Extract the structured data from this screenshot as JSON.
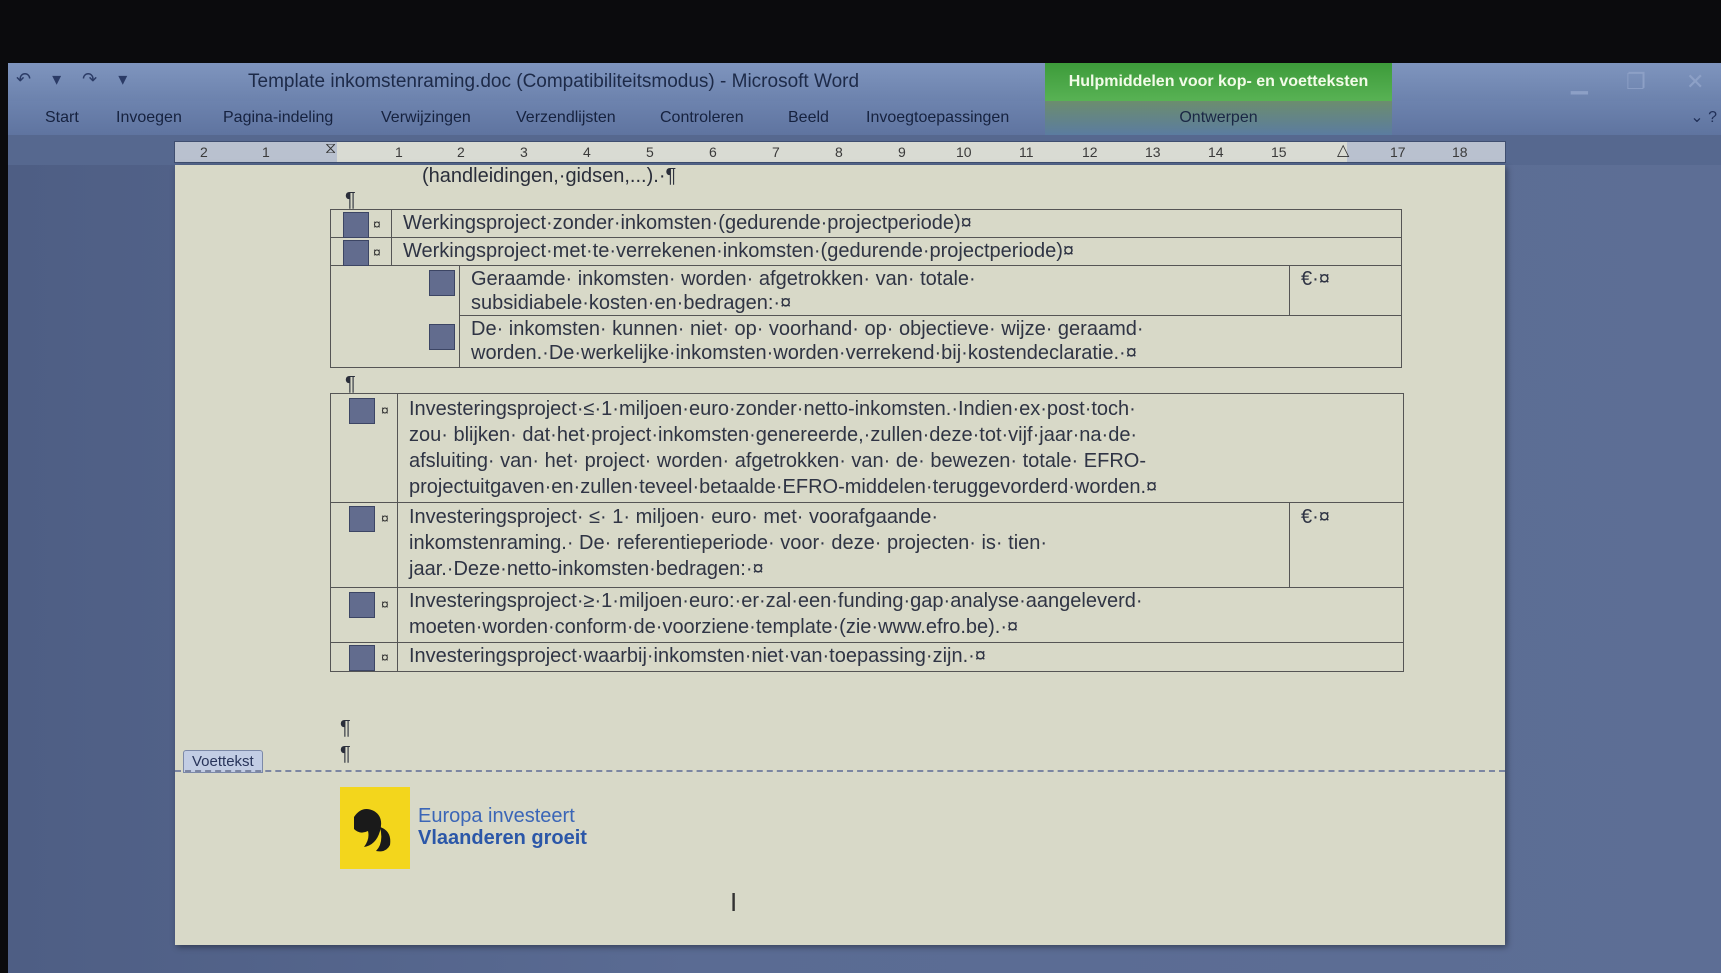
{
  "app": {
    "doc_title": "Template inkomstenraming.doc (Compatibiliteitsmodus) - Microsoft Word",
    "context_tab_group": "Hulpmiddelen voor kop- en voetteksten"
  },
  "ribbon": {
    "tabs": [
      "Start",
      "Invoegen",
      "Pagina-indeling",
      "Verwijzingen",
      "Verzendlijsten",
      "Controleren",
      "Beeld",
      "Invoegtoepassingen"
    ],
    "context_tab": "Ontwerpen"
  },
  "ruler": {
    "numbers": [
      "2",
      "1",
      "1",
      "2",
      "3",
      "4",
      "5",
      "6",
      "7",
      "8",
      "9",
      "10",
      "11",
      "12",
      "13",
      "14",
      "15",
      "17",
      "18"
    ]
  },
  "document": {
    "top_line": "(handleidingen,·gidsen,...).·¶",
    "pilcrow": "¶",
    "table1": {
      "rows": [
        "Werkingsproject·zonder·inkomsten·(gedurende·projectperiode)¤",
        "Werkingsproject·met·te·verrekenen·inkomsten·(gedurende·projectperiode)¤"
      ],
      "sub1_line1": "Geraamde· inkomsten· worden· afgetrokken· van· totale·",
      "sub1_line2": "subsidiabele·kosten·en·bedragen:·¤",
      "sub1_currency": "€·¤",
      "sub2_line1": "De· inkomsten· kunnen· niet· op· voorhand· op· objectieve· wijze· geraamd·",
      "sub2_line2": "worden.·De·werkelijke·inkomsten·worden·verrekend·bij·kostendeclaratie.·¤"
    },
    "table2": {
      "r1_line1": "Investeringsproject·≤·1·miljoen·euro·zonder·netto-inkomsten.·Indien·ex·post·toch·",
      "r1_line2": "zou· blijken· dat·het·project·inkomsten·genereerde,·zullen·deze·tot·vijf·jaar·na·de·",
      "r1_line3": "afsluiting· van· het· project· worden· afgetrokken· van· de· bewezen· totale· EFRO-",
      "r1_line4": "projectuitgaven·en·zullen·teveel·betaalde·EFRO-middelen·teruggevorderd·worden.¤",
      "r2_line1": "Investeringsproject·   ≤·   1·   miljoen·   euro·   met·   voorafgaande·",
      "r2_line2": "inkomstenraming.· De· referentieperiode· voor· deze· projecten· is· tien·",
      "r2_line3": "jaar.·Deze·netto-inkomsten·bedragen:·¤",
      "r2_currency": "€·¤",
      "r3_line1": "Investeringsproject·≥·1·miljoen·euro:·er·zal·een·funding·gap·analyse·aangeleverd·",
      "r3_line2": "moeten·worden·conform·de·voorziene·template·(zie·www.efro.be).·¤",
      "r4_line1": "Investeringsproject·waarbij·inkomsten·niet·van·toepassing·zijn.·¤"
    },
    "cell_end_mark": "¤",
    "footer_tag": "Voettekst",
    "logo_line1": "Europa investeert",
    "logo_line2": "Vlaanderen groeit"
  },
  "colors": {
    "context_green": "#58b254",
    "checkbox": "#626c8e",
    "logo_yellow": "#f3d61c",
    "logo_blue": "#3b66b7"
  }
}
